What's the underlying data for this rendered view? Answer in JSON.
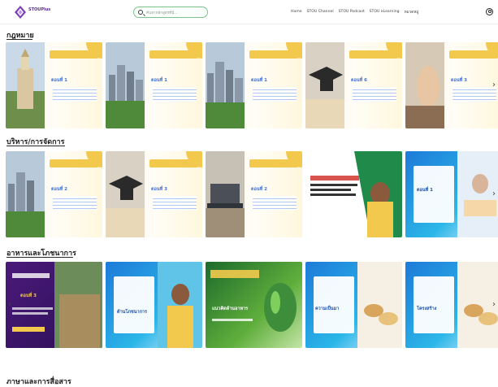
{
  "header": {
    "logo_text": "STOUPlus",
    "logo_sub": "",
    "search_placeholder": "ค้นหาหลักสูตรที่นี่...",
    "nav": [
      "Home",
      "STOU Channel",
      "STOU Podcast",
      "STOU eLearning",
      "หมวดหมู่"
    ],
    "accent": "#5b2c8f"
  },
  "sections": [
    {
      "title": "กฎหมาย",
      "cards": [
        {
          "label": "ตอนที่ 1",
          "style": "law"
        },
        {
          "label": "ตอนที่ 1",
          "style": "law"
        },
        {
          "label": "ตอนที่ 1",
          "style": "law"
        },
        {
          "label": "ตอนที่ 6",
          "style": "law"
        },
        {
          "label": "ตอนที่ 3",
          "style": "law"
        }
      ]
    },
    {
      "title": "บริหาร/การจัดการ",
      "cards": [
        {
          "label": "ตอนที่ 2",
          "style": "law"
        },
        {
          "label": "ตอนที่ 3",
          "style": "law"
        },
        {
          "label": "ตอนที่ 2",
          "style": "law"
        },
        {
          "label": "",
          "style": "green-speaker"
        },
        {
          "label": "ตอนที่ 1",
          "style": "blue"
        }
      ]
    },
    {
      "title": "อาหารและโภชนาการ",
      "cards": [
        {
          "label": "ตอนที่ 3",
          "style": "dark"
        },
        {
          "label": "ด้านโภชนาการ",
          "style": "blue"
        },
        {
          "label": "แนวคิดด้านอาหาร",
          "style": "green"
        },
        {
          "label": "ความเป็นมา",
          "style": "blue"
        },
        {
          "label": "โครงสร้าง",
          "style": "blue"
        }
      ]
    },
    {
      "title": "ภาษาและการสื่อสาร",
      "cards": []
    }
  ]
}
